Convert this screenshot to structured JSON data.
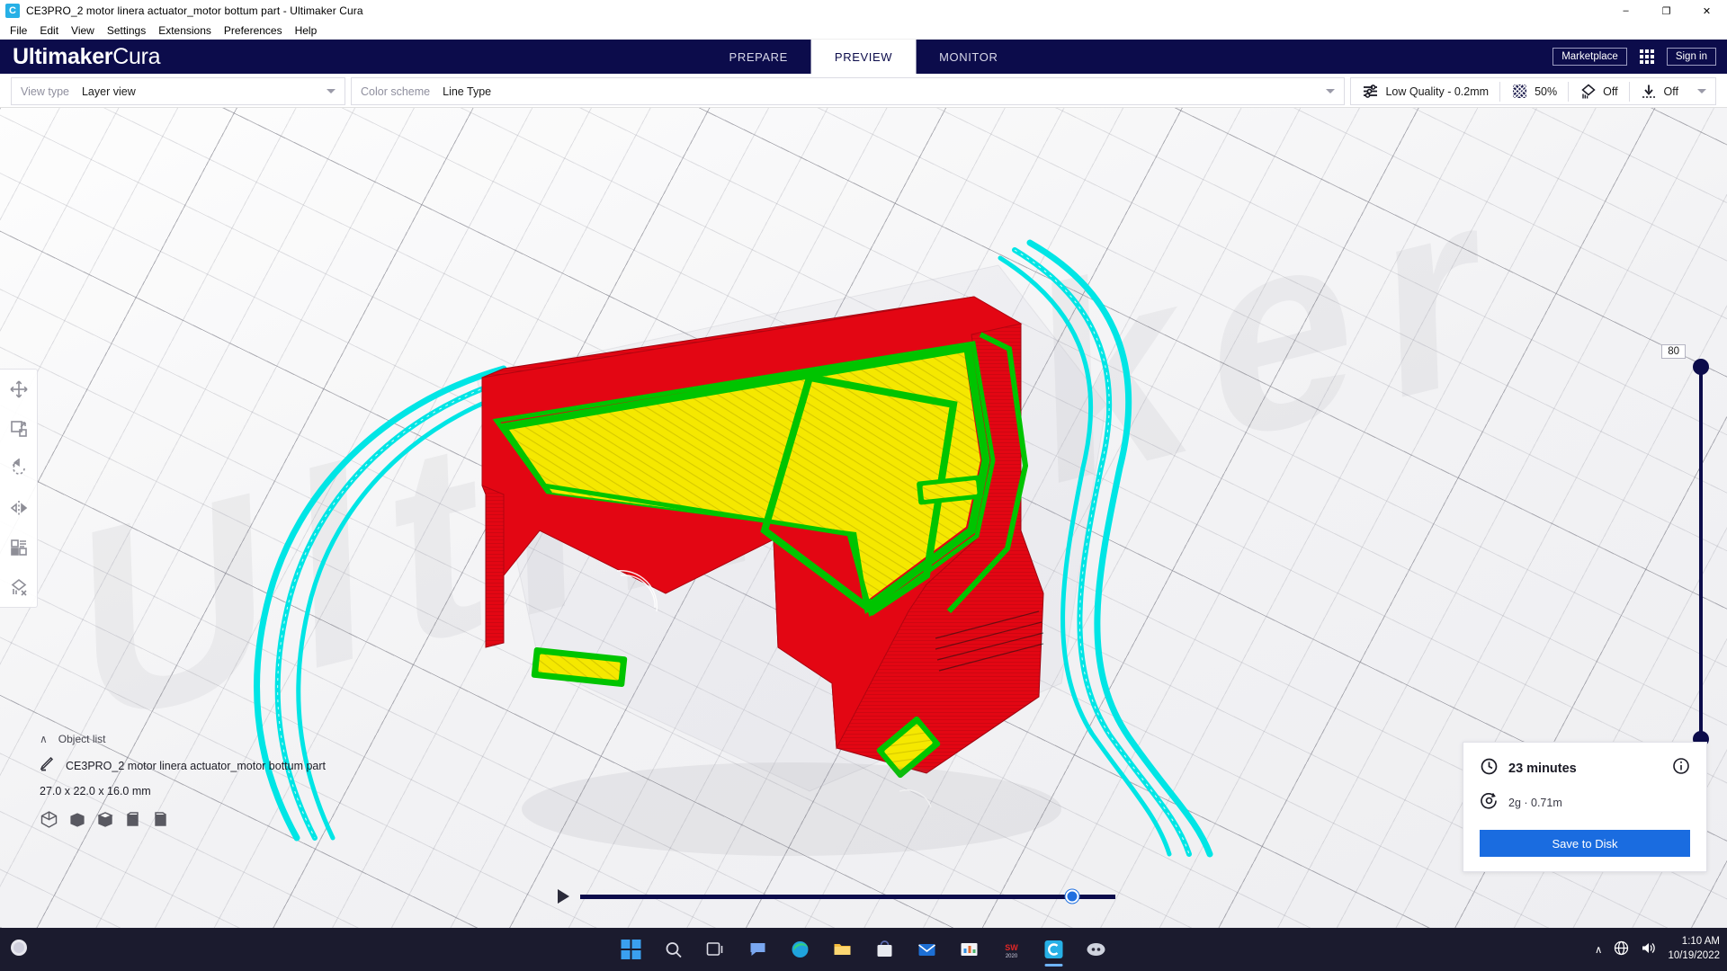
{
  "window": {
    "title": "CE3PRO_2 motor linera actuator_motor bottum part - Ultimaker Cura",
    "app_icon": "cura-icon",
    "minimize": "–",
    "maximize": "❐",
    "close": "✕"
  },
  "menu": {
    "items": [
      {
        "label": "File"
      },
      {
        "label": "Edit"
      },
      {
        "label": "View"
      },
      {
        "label": "Settings"
      },
      {
        "label": "Extensions"
      },
      {
        "label": "Preferences"
      },
      {
        "label": "Help"
      }
    ]
  },
  "header": {
    "logo_bold": "Ultimaker",
    "logo_light": "Cura",
    "stages": [
      {
        "label": "PREPARE",
        "active": false
      },
      {
        "label": "PREVIEW",
        "active": true
      },
      {
        "label": "MONITOR",
        "active": false
      }
    ],
    "marketplace": "Marketplace",
    "apps_icon": "grid-apps-icon",
    "signin": "Sign in"
  },
  "viewbar": {
    "view_type_label": "View type",
    "view_type_value": "Layer view",
    "color_scheme_label": "Color scheme",
    "color_scheme_value": "Line Type",
    "profile_icon": "sliders-icon",
    "profile_value": "Low Quality - 0.2mm",
    "infill_icon": "infill-icon",
    "infill_value": "50%",
    "support_icon": "support-icon",
    "support_value": "Off",
    "adhesion_icon": "adhesion-icon",
    "adhesion_value": "Off"
  },
  "viewport": {
    "watermark": "Ultimaker",
    "accent_navy": "#0c0c4b",
    "model_colors": {
      "walls": "#e30613",
      "inner_wall": "#00c400",
      "infill": "#f5e800",
      "travel": "#00e5e5",
      "skirt": "#00e5e5"
    }
  },
  "left_tools": [
    {
      "name": "move-tool",
      "label": "Move"
    },
    {
      "name": "scale-tool",
      "label": "Scale"
    },
    {
      "name": "rotate-tool",
      "label": "Rotate"
    },
    {
      "name": "mirror-tool",
      "label": "Mirror"
    },
    {
      "name": "per-model-settings-tool",
      "label": "Per Model Settings"
    },
    {
      "name": "support-blocker-tool",
      "label": "Support Blocker"
    }
  ],
  "layer_slider": {
    "value": "80",
    "min": "1",
    "max": "80"
  },
  "object_list": {
    "caret": "∧",
    "title": "Object list",
    "edit_icon": "pencil-icon",
    "object_name": "CE3PRO_2 motor linera actuator_motor bottum part",
    "dimensions": "27.0 x 22.0 x 16.0 mm",
    "view_buttons": [
      {
        "name": "view-3d",
        "label": "3D View"
      },
      {
        "name": "view-front",
        "label": "Front View"
      },
      {
        "name": "view-top",
        "label": "Top View"
      },
      {
        "name": "view-left",
        "label": "Left View"
      },
      {
        "name": "view-right",
        "label": "Right View"
      }
    ]
  },
  "playback": {
    "play_icon": "play-icon",
    "progress_percent": 92
  },
  "print_info": {
    "time_icon": "clock-icon",
    "time": "23 minutes",
    "material_icon": "spool-icon",
    "material": "2g · 0.71m",
    "info_icon": "info-icon",
    "save_label": "Save to Disk"
  },
  "taskbar": {
    "weather_temp": "",
    "start_icon": "windows-start-icon",
    "icons": [
      {
        "name": "taskbar-start-icon",
        "glyph": "start",
        "active": false
      },
      {
        "name": "taskbar-search-icon",
        "glyph": "search",
        "active": false
      },
      {
        "name": "taskbar-taskview-icon",
        "glyph": "taskview",
        "active": false
      },
      {
        "name": "taskbar-chat-icon",
        "glyph": "chat",
        "active": false
      },
      {
        "name": "taskbar-edge-icon",
        "glyph": "edge",
        "active": false
      },
      {
        "name": "taskbar-explorer-icon",
        "glyph": "explorer",
        "active": false
      },
      {
        "name": "taskbar-store-icon",
        "glyph": "store",
        "active": false
      },
      {
        "name": "taskbar-mail-icon",
        "glyph": "mail",
        "active": false
      },
      {
        "name": "taskbar-charts-icon",
        "glyph": "charts",
        "active": false
      },
      {
        "name": "taskbar-solidworks-icon",
        "glyph": "sw",
        "active": false
      },
      {
        "name": "taskbar-cura-icon",
        "glyph": "cura",
        "active": true
      },
      {
        "name": "taskbar-discord-icon",
        "glyph": "discord",
        "active": false
      }
    ],
    "tray": {
      "chevron": "∧",
      "network_icon": "network-icon",
      "volume_icon": "volume-icon"
    },
    "time": "1:10 AM",
    "date": "10/19/2022"
  }
}
